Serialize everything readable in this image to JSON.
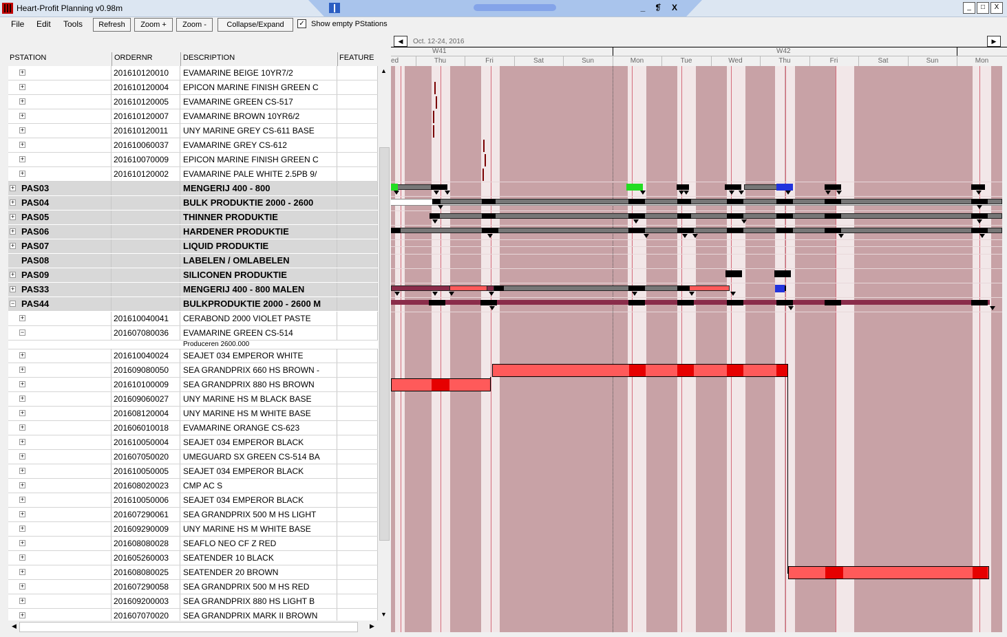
{
  "window": {
    "title": "Heart-Profit Planning v0.98m",
    "restore_glyph": "❡",
    "min": "_",
    "max": "□",
    "close": "X"
  },
  "menu": {
    "file": "File",
    "edit": "Edit",
    "tools": "Tools"
  },
  "toolbar": {
    "refresh": "Refresh",
    "zoom_in": "Zoom +",
    "zoom_out": "Zoom -",
    "collapse": "Collapse/Expand",
    "show_empty_checked": true,
    "show_empty_label": "Show empty PStations"
  },
  "grid": {
    "headers": {
      "pstation": "PSTATION",
      "ordernr": "ORDERNR",
      "description": "DESCRIPTION",
      "feature": "FEATURE"
    },
    "rows": [
      {
        "type": "order",
        "order": "201610120010",
        "desc": "EVAMARINE BEIGE 10YR7/2"
      },
      {
        "type": "order",
        "order": "201610120004",
        "desc": "EPICON MARINE FINISH GREEN C"
      },
      {
        "type": "order",
        "order": "201610120005",
        "desc": "EVAMARINE GREEN CS-517"
      },
      {
        "type": "order",
        "order": "201610120007",
        "desc": "EVAMARINE BROWN 10YR6/2"
      },
      {
        "type": "order",
        "order": "201610120011",
        "desc": "UNY MARINE GREY CS-611 BASE"
      },
      {
        "type": "order",
        "order": "201610060037",
        "desc": "EVAMARINE GREY CS-612"
      },
      {
        "type": "order",
        "order": "201610070009",
        "desc": "EPICON MARINE FINISH GREEN C"
      },
      {
        "type": "order",
        "order": "201610120002",
        "desc": "EVAMARINE PALE WHITE 2.5PB 9/"
      },
      {
        "type": "ps",
        "ps": "PAS03",
        "desc": "MENGERIJ 400 - 800",
        "exp": "+"
      },
      {
        "type": "ps",
        "ps": "PAS04",
        "desc": "BULK PRODUKTIE 2000 - 2600",
        "exp": "+"
      },
      {
        "type": "ps",
        "ps": "PAS05",
        "desc": "THINNER PRODUKTIE",
        "exp": "+"
      },
      {
        "type": "ps",
        "ps": "PAS06",
        "desc": "HARDENER PRODUKTIE",
        "exp": "+"
      },
      {
        "type": "ps",
        "ps": "PAS07",
        "desc": "LIQUID PRODUKTIE",
        "exp": "+"
      },
      {
        "type": "ps",
        "ps": "PAS08",
        "desc": "LABELEN / OMLABELEN",
        "exp": ""
      },
      {
        "type": "ps",
        "ps": "PAS09",
        "desc": "SILICONEN PRODUKTIE",
        "exp": "+"
      },
      {
        "type": "ps",
        "ps": "PAS33",
        "desc": "MENGERIJ 400 - 800 MALEN",
        "exp": "+"
      },
      {
        "type": "ps",
        "ps": "PAS44",
        "desc": "BULKPRODUKTIE 2000 - 2600 M",
        "exp": "−"
      },
      {
        "type": "order",
        "order": "201610040041",
        "desc": "CERABOND 2000 VIOLET PASTE"
      },
      {
        "type": "order",
        "order": "201607080036",
        "desc": "EVAMARINE GREEN CS-514",
        "exp": "−"
      },
      {
        "type": "sub",
        "desc": "Produceren 2600.000"
      },
      {
        "type": "order",
        "order": "201610040024",
        "desc": "SEAJET 034 EMPEROR WHITE"
      },
      {
        "type": "order",
        "order": "201609080050",
        "desc": "SEA GRANDPRIX 660 HS BROWN -"
      },
      {
        "type": "order",
        "order": "201610100009",
        "desc": "SEA GRANDPRIX 880 HS BROWN"
      },
      {
        "type": "order",
        "order": "201609060027",
        "desc": "UNY MARINE HS M BLACK BASE"
      },
      {
        "type": "order",
        "order": "201608120004",
        "desc": "UNY MARINE HS M WHITE BASE"
      },
      {
        "type": "order",
        "order": "201606010018",
        "desc": "EVAMARINE ORANGE CS-623"
      },
      {
        "type": "order",
        "order": "201610050004",
        "desc": "SEAJET 034 EMPEROR BLACK"
      },
      {
        "type": "order",
        "order": "201607050020",
        "desc": "UMEGUARD SX GREEN CS-514 BA"
      },
      {
        "type": "order",
        "order": "201610050005",
        "desc": "SEAJET 034 EMPEROR BLACK"
      },
      {
        "type": "order",
        "order": "201608020023",
        "desc": "CMP AC S"
      },
      {
        "type": "order",
        "order": "201610050006",
        "desc": "SEAJET 034 EMPEROR BLACK"
      },
      {
        "type": "order",
        "order": "201607290061",
        "desc": "SEA GRANDPRIX 500 M HS LIGHT"
      },
      {
        "type": "order",
        "order": "201609290009",
        "desc": "UNY MARINE HS M WHITE BASE"
      },
      {
        "type": "order",
        "order": "201608080028",
        "desc": "SEAFLO NEO CF Z RED"
      },
      {
        "type": "order",
        "order": "201605260003",
        "desc": "SEATENDER 10 BLACK"
      },
      {
        "type": "order",
        "order": "201608080025",
        "desc": "SEATENDER 20 BROWN"
      },
      {
        "type": "order",
        "order": "201607290058",
        "desc": "SEA GRANDPRIX 500 M HS RED"
      },
      {
        "type": "order",
        "order": "201609200003",
        "desc": "SEA GRANDPRIX 880 HS LIGHT B"
      },
      {
        "type": "order",
        "order": "201607070020",
        "desc": "SEA GRANDPRIX MARK II BROWN"
      }
    ]
  },
  "scroll": {
    "up": "▲",
    "down": "▼",
    "left": "◀",
    "right": "▶"
  },
  "gantt": {
    "range_label": "Oct. 12-24, 2016",
    "weeks": [
      "W41",
      "W42"
    ],
    "days": [
      "ed",
      "Thu",
      "Fri",
      "Sat",
      "Sun",
      "Mon",
      "Tue",
      "Wed",
      "Thu",
      "Fri",
      "Sat",
      "Sun",
      "Mon"
    ],
    "colors": {
      "weekend": "#c8a2a6",
      "workday": "#cba7ab",
      "bar_gray": "#777777",
      "bar_red": "#ff5a5a",
      "bar_maroon": "#8a2c4a",
      "green": "#22dd22",
      "blue": "#2233dd"
    },
    "icons": {
      "collapse": "expand-collapse-icon",
      "nav_prev": "arrow-left-icon",
      "nav_next": "arrow-right-icon"
    }
  }
}
